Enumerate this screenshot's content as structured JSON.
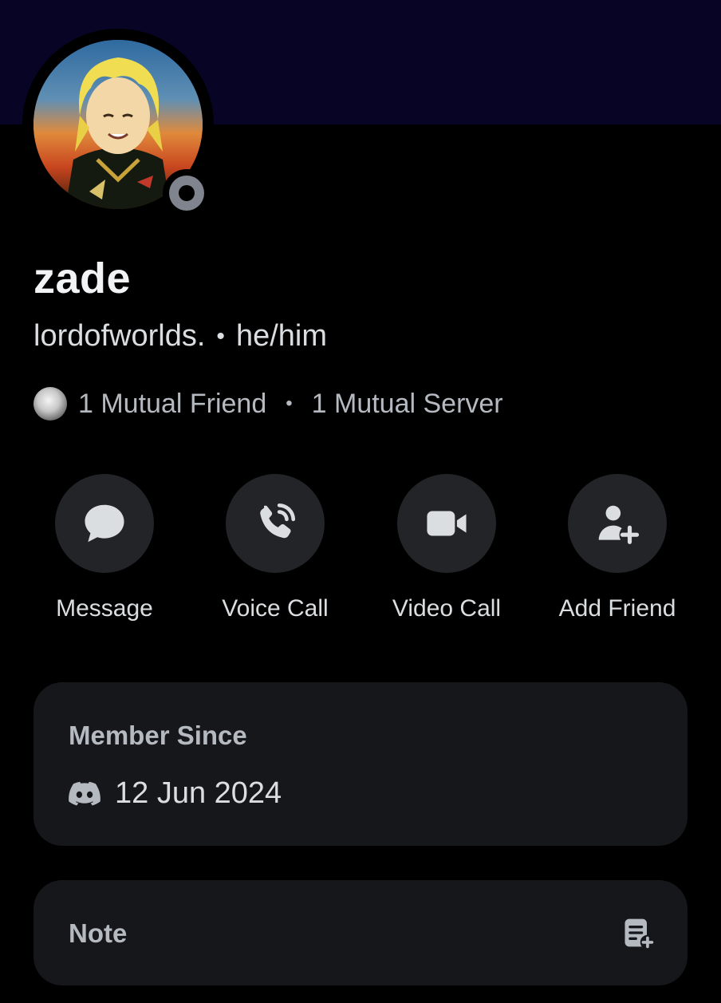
{
  "profile": {
    "display_name": "zade",
    "username": "lordofworlds.",
    "separator": "•",
    "pronouns": "he/him",
    "status": "offline"
  },
  "mutuals": {
    "friends": "1 Mutual Friend",
    "separator": "•",
    "servers": "1 Mutual Server"
  },
  "actions": [
    {
      "label": "Message",
      "icon": "chat-bubble-icon"
    },
    {
      "label": "Voice Call",
      "icon": "phone-icon"
    },
    {
      "label": "Video Call",
      "icon": "video-camera-icon"
    },
    {
      "label": "Add Friend",
      "icon": "add-friend-icon"
    }
  ],
  "member_since": {
    "title": "Member Since",
    "date": "12 Jun 2024",
    "icon": "discord-logo-icon"
  },
  "note": {
    "title": "Note",
    "icon": "add-note-icon"
  },
  "colors": {
    "banner": "#070426",
    "background": "#000000",
    "card": "#16171b",
    "action_circle": "#232428",
    "status_offline": "#80848e"
  }
}
